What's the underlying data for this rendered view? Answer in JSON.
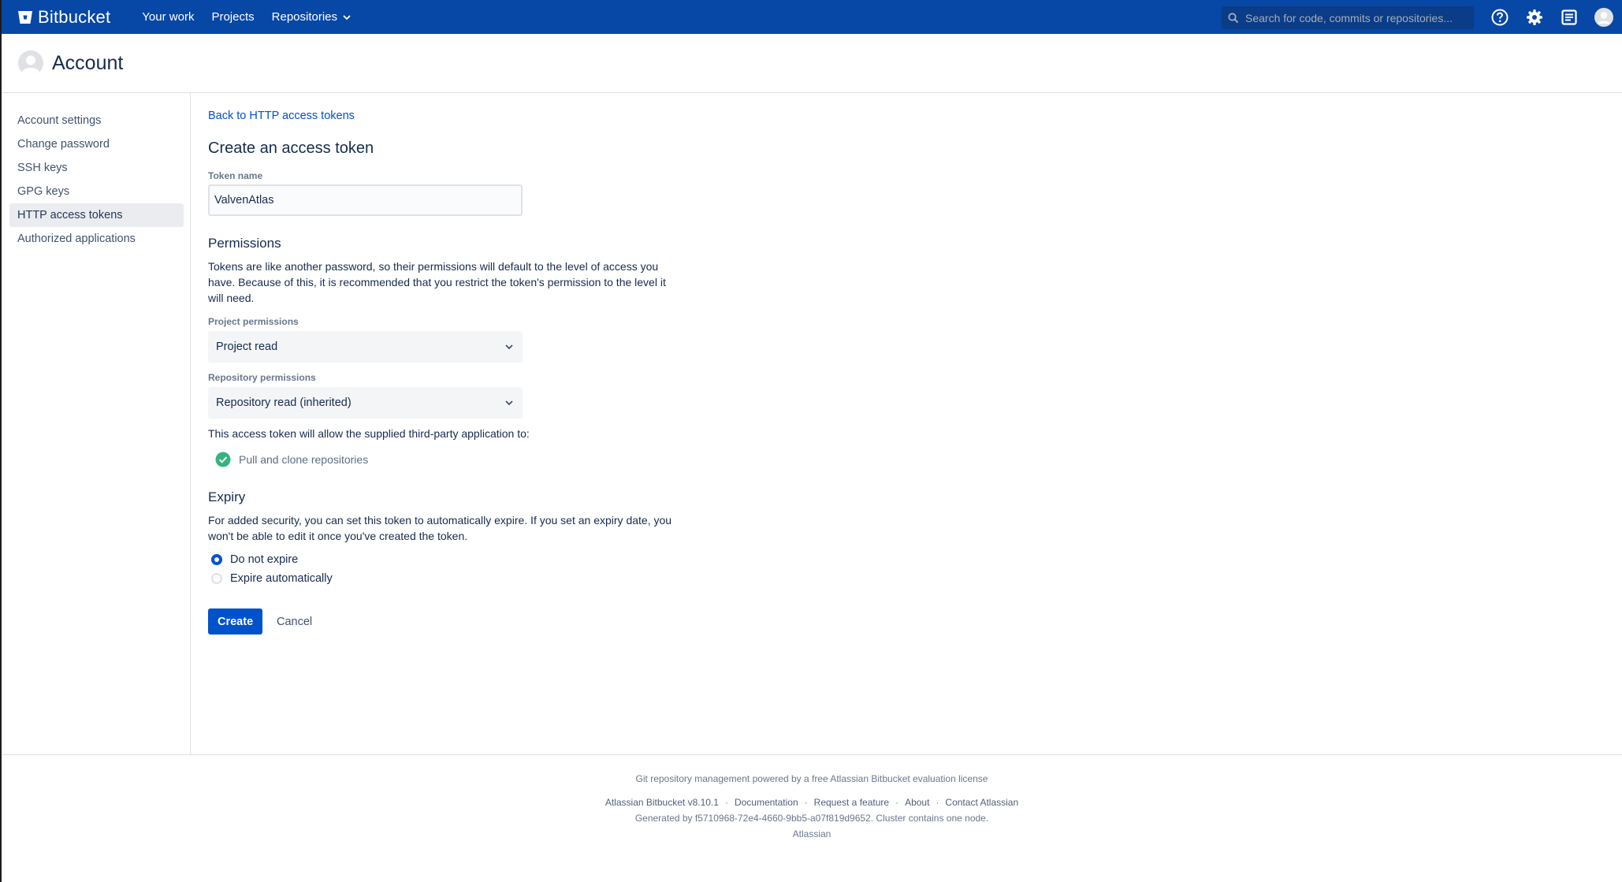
{
  "topnav": {
    "brand": "Bitbucket",
    "links": [
      "Your work",
      "Projects",
      "Repositories"
    ],
    "search_placeholder": "Search for code, commits or repositories...",
    "icons": [
      "help-icon",
      "gear-icon",
      "notes-icon",
      "avatar-icon"
    ],
    "bg_color": "#0747a6"
  },
  "header": {
    "title": "Account"
  },
  "sidebar": {
    "items": [
      {
        "label": "Account settings"
      },
      {
        "label": "Change password"
      },
      {
        "label": "SSH keys"
      },
      {
        "label": "GPG keys"
      },
      {
        "label": "HTTP access tokens",
        "active": true
      },
      {
        "label": "Authorized applications"
      }
    ]
  },
  "main": {
    "back_link": "Back to HTTP access tokens",
    "title": "Create an access token",
    "token_name_label": "Token name",
    "token_name_value": "ValvenAtlas",
    "permissions_heading": "Permissions",
    "permissions_text": "Tokens are like another password, so their permissions will default to the level of access you have. Because of this, it is recommended that you restrict the token's permission to the level it will need.",
    "project_perm_label": "Project permissions",
    "project_perm_value": "Project read",
    "repo_perm_label": "Repository permissions",
    "repo_perm_value": "Repository read (inherited)",
    "allow_text": "This access token will allow the supplied third-party application to:",
    "allowed_items": [
      "Pull and clone repositories"
    ],
    "expiry_heading": "Expiry",
    "expiry_text": "For added security, you can set this token to automatically expire. If you set an expiry date, you won't be able to edit it once you've created the token.",
    "expiry_options": [
      {
        "label": "Do not expire",
        "checked": true
      },
      {
        "label": "Expire automatically",
        "checked": false
      }
    ],
    "create_label": "Create",
    "cancel_label": "Cancel"
  },
  "footer": {
    "license_text": "Git repository management powered by a free Atlassian Bitbucket evaluation license",
    "links": [
      "Atlassian Bitbucket v8.10.1",
      "Documentation",
      "Request a feature",
      "About",
      "Contact Atlassian"
    ],
    "generated_text": "Generated by f5710968-72e4-4660-9bb5-a07f819d9652. Cluster contains one node.",
    "company": "Atlassian"
  },
  "colors": {
    "accent": "#0052cc",
    "success": "#36b37e"
  }
}
